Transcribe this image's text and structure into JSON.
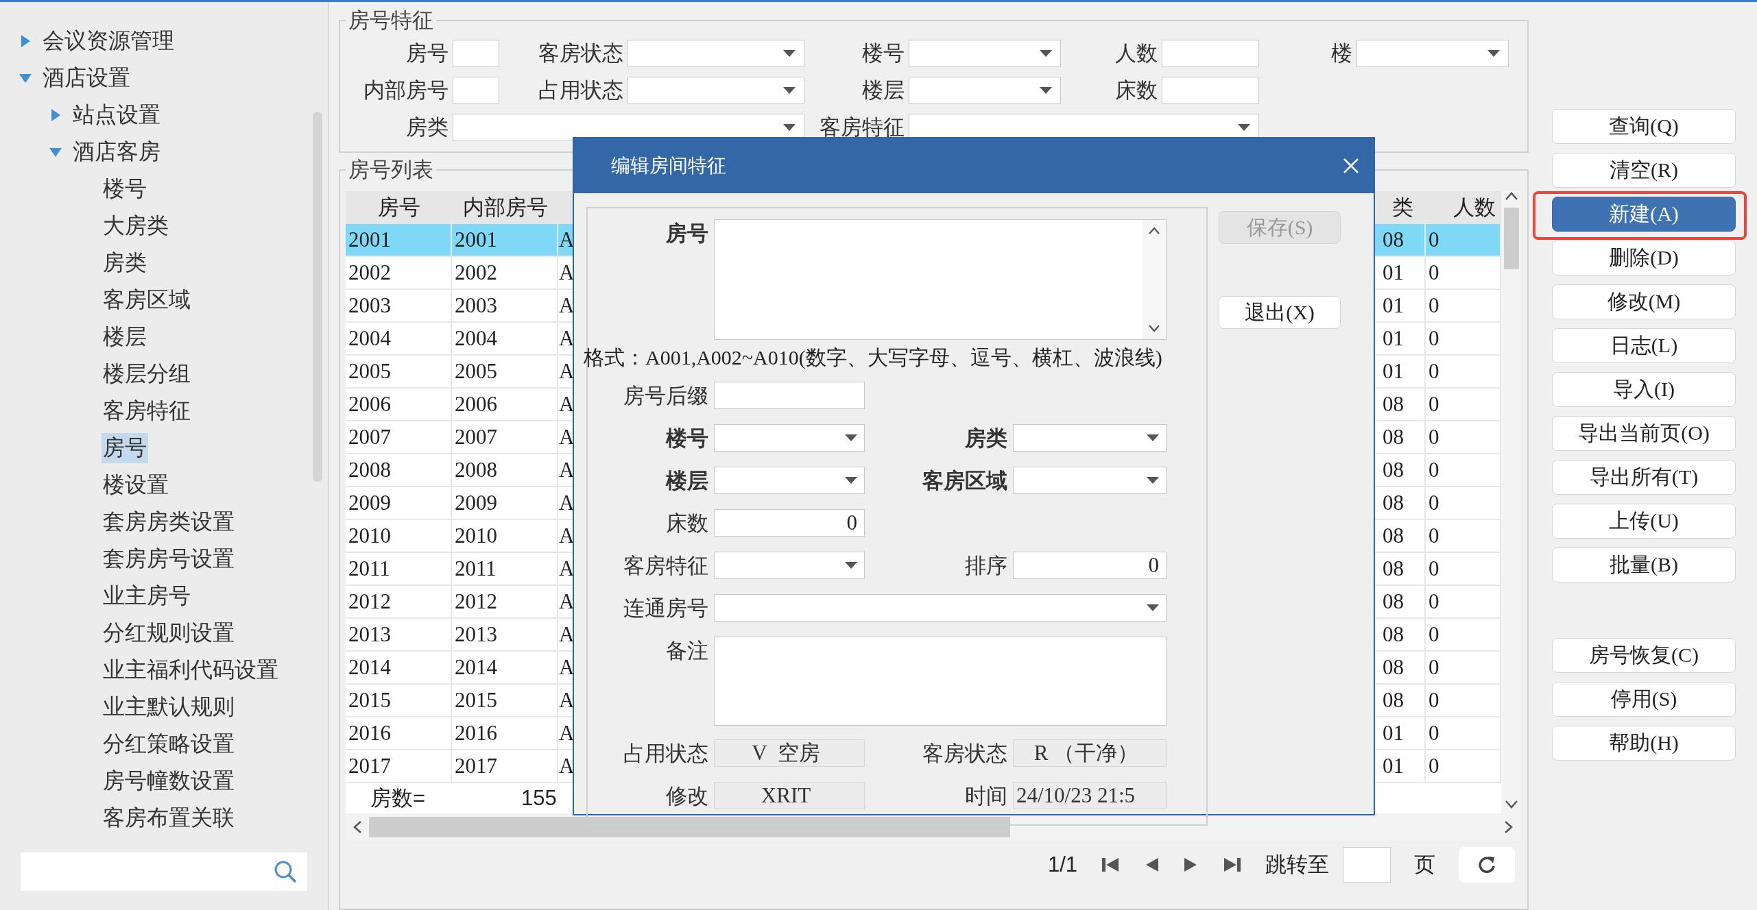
{
  "sidebar": {
    "tree": [
      {
        "label": "会议资源管理",
        "expanded": false,
        "selected": false
      },
      {
        "label": "酒店设置",
        "expanded": true,
        "selected": false,
        "children": [
          {
            "label": "站点设置",
            "expanded": false,
            "selected": false
          },
          {
            "label": "酒店客房",
            "expanded": true,
            "selected": false,
            "children": [
              {
                "label": "楼号",
                "selected": false
              },
              {
                "label": "大房类",
                "selected": false
              },
              {
                "label": "房类",
                "selected": false
              },
              {
                "label": "客房区域",
                "selected": false
              },
              {
                "label": "楼层",
                "selected": false
              },
              {
                "label": "楼层分组",
                "selected": false
              },
              {
                "label": "客房特征",
                "selected": false
              },
              {
                "label": "房号",
                "selected": true
              },
              {
                "label": "楼设置",
                "selected": false
              },
              {
                "label": "套房房类设置",
                "selected": false
              },
              {
                "label": "套房房号设置",
                "selected": false
              },
              {
                "label": "业主房号",
                "selected": false
              },
              {
                "label": "分红规则设置",
                "selected": false
              },
              {
                "label": "业主福利代码设置",
                "selected": false
              },
              {
                "label": "业主默认规则",
                "selected": false
              },
              {
                "label": "分红策略设置",
                "selected": false
              },
              {
                "label": "房号幢数设置",
                "selected": false
              },
              {
                "label": "客房布置关联",
                "selected": false
              }
            ]
          }
        ]
      }
    ]
  },
  "filter": {
    "title": "房号特征",
    "rows": [
      [
        {
          "label": "房号",
          "kind": "short"
        },
        {
          "label": "客房状态",
          "kind": "select"
        },
        {
          "label": "楼号",
          "kind": "select"
        },
        {
          "label": "人数",
          "kind": "text"
        },
        {
          "label": "楼",
          "kind": "select"
        }
      ],
      [
        {
          "label": "内部房号",
          "kind": "short"
        },
        {
          "label": "占用状态",
          "kind": "select"
        },
        {
          "label": "楼层",
          "kind": "select"
        },
        {
          "label": "床数",
          "kind": "text"
        }
      ],
      [
        {
          "label": "房类",
          "kind": "wide"
        },
        "",
        {
          "label": "客房特征",
          "kind": "wide"
        }
      ]
    ]
  },
  "table": {
    "title": "房号列表",
    "columns": [
      "房号",
      "内部房号",
      "类",
      "人数"
    ],
    "rows": [
      {
        "cells": [
          "2001",
          "2001",
          "A",
          "08",
          "0"
        ],
        "selected": true
      },
      {
        "cells": [
          "2002",
          "2002",
          "A",
          "01",
          "0"
        ],
        "selected": false
      },
      {
        "cells": [
          "2003",
          "2003",
          "A",
          "01",
          "0"
        ],
        "selected": false
      },
      {
        "cells": [
          "2004",
          "2004",
          "A",
          "01",
          "0"
        ],
        "selected": false
      },
      {
        "cells": [
          "2005",
          "2005",
          "A",
          "01",
          "0"
        ],
        "selected": false
      },
      {
        "cells": [
          "2006",
          "2006",
          "A",
          "08",
          "0"
        ],
        "selected": false
      },
      {
        "cells": [
          "2007",
          "2007",
          "A",
          "08",
          "0"
        ],
        "selected": false
      },
      {
        "cells": [
          "2008",
          "2008",
          "A",
          "08",
          "0"
        ],
        "selected": false
      },
      {
        "cells": [
          "2009",
          "2009",
          "A",
          "08",
          "0"
        ],
        "selected": false
      },
      {
        "cells": [
          "2010",
          "2010",
          "A",
          "08",
          "0"
        ],
        "selected": false
      },
      {
        "cells": [
          "2011",
          "2011",
          "A",
          "08",
          "0"
        ],
        "selected": false
      },
      {
        "cells": [
          "2012",
          "2012",
          "A",
          "08",
          "0"
        ],
        "selected": false
      },
      {
        "cells": [
          "2013",
          "2013",
          "A",
          "08",
          "0"
        ],
        "selected": false
      },
      {
        "cells": [
          "2014",
          "2014",
          "A",
          "08",
          "0"
        ],
        "selected": false
      },
      {
        "cells": [
          "2015",
          "2015",
          "A",
          "08",
          "0"
        ],
        "selected": false
      },
      {
        "cells": [
          "2016",
          "2016",
          "A",
          "01",
          "0"
        ],
        "selected": false
      },
      {
        "cells": [
          "2017",
          "2017",
          "A",
          "01",
          "0"
        ],
        "selected": false
      }
    ],
    "footer": {
      "label": "房数=",
      "value": "155"
    }
  },
  "pager": {
    "page": "1/1",
    "goto_label": "跳转至",
    "page_unit": "页"
  },
  "buttons": {
    "groups": [
      [
        {
          "label": "查询(Q)",
          "focused": false,
          "highlighted": false
        },
        {
          "label": "清空(R)",
          "focused": false,
          "highlighted": false
        },
        {
          "label": "新建(A)",
          "focused": true,
          "highlighted": true
        },
        {
          "label": "删除(D)",
          "focused": false,
          "highlighted": false
        },
        {
          "label": "修改(M)",
          "focused": false,
          "highlighted": false
        },
        {
          "label": "日志(L)",
          "focused": false,
          "highlighted": false
        },
        {
          "label": "导入(I)",
          "focused": false,
          "highlighted": false
        },
        {
          "label": "导出当前页(O)",
          "focused": false,
          "highlighted": false
        },
        {
          "label": "导出所有(T)",
          "focused": false,
          "highlighted": false
        },
        {
          "label": "上传(U)",
          "focused": false,
          "highlighted": false
        },
        {
          "label": "批量(B)",
          "focused": false,
          "highlighted": false
        }
      ],
      [
        {
          "label": "房号恢复(C)",
          "focused": false,
          "highlighted": false
        },
        {
          "label": "停用(S)",
          "focused": false,
          "highlighted": false
        },
        {
          "label": "帮助(H)",
          "focused": false,
          "highlighted": false
        }
      ]
    ]
  },
  "dialog": {
    "title": "编辑房间特征",
    "rows": [
      [
        {
          "label": "房号",
          "kind": "textarea",
          "required": true,
          "scrollable": true
        }
      ],
      [
        {
          "kind": "note",
          "text": "格式：A001,A002~A010(数字、大写字母、逗号、横杠、波浪线)"
        }
      ],
      [
        {
          "label": "房号后缀",
          "kind": "text",
          "required": false
        }
      ],
      [
        {
          "label": "楼号",
          "kind": "select",
          "required": true
        },
        {
          "label": "房类",
          "kind": "select",
          "required": true
        }
      ],
      [
        {
          "label": "楼层",
          "kind": "select",
          "required": true
        },
        {
          "label": "客房区域",
          "kind": "select",
          "required": true
        }
      ],
      [
        {
          "label": "床数",
          "kind": "number",
          "required": false,
          "value": "0"
        }
      ],
      [
        {
          "label": "客房特征",
          "kind": "select",
          "required": false
        },
        {
          "label": "排序",
          "kind": "number",
          "required": false,
          "value": "0"
        }
      ],
      [
        {
          "label": "连通房号",
          "kind": "wideselect",
          "required": false
        }
      ],
      [
        {
          "label": "备注",
          "kind": "textarea",
          "required": false,
          "scrollable": false
        }
      ],
      [
        {
          "label": "占用状态",
          "kind": "readonly",
          "required": false,
          "value": "V  空房"
        },
        {
          "label": "客房状态",
          "kind": "readonly",
          "required": false,
          "value": "R （干净）"
        }
      ],
      [
        {
          "label": "修改",
          "kind": "readonly",
          "required": false,
          "value": "XRIT"
        },
        {
          "label": "时间",
          "kind": "readonly",
          "required": false,
          "value": "24/10/23 21:5"
        }
      ]
    ],
    "actions": [
      {
        "label": "保存(S)",
        "disabled": true
      },
      {
        "label": "退出(X)",
        "disabled": false
      }
    ]
  }
}
